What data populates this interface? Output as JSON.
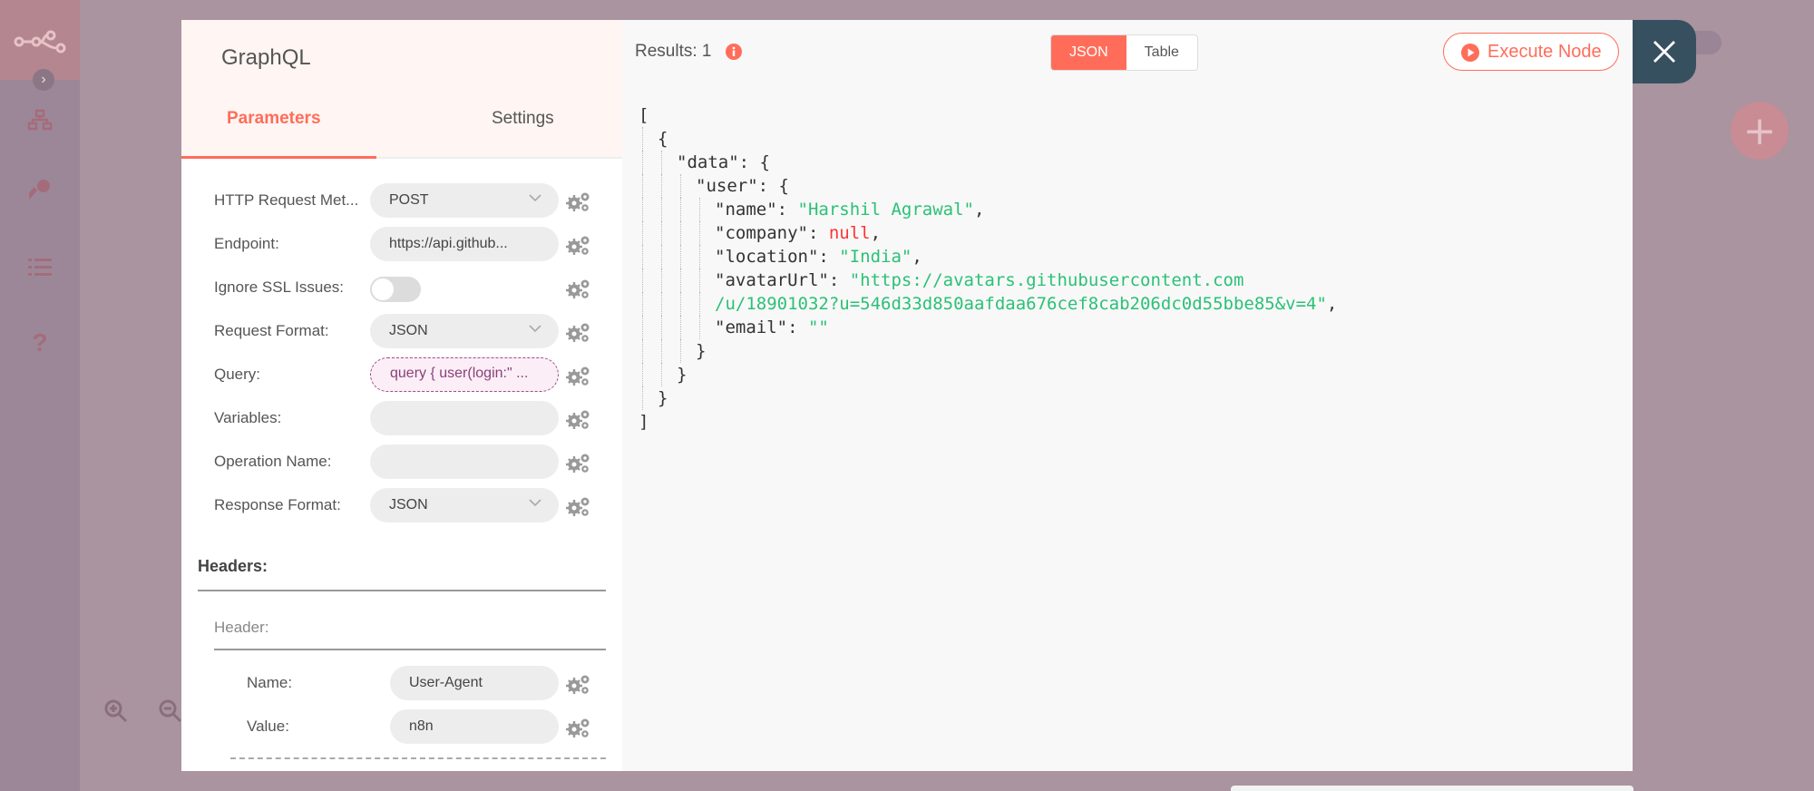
{
  "colors": {
    "accent": "#ff6d5a",
    "close_bg": "#37505f",
    "json_string": "#2bc176",
    "json_null": "#ff3333",
    "query_text": "#8b3f78"
  },
  "node": {
    "title": "GraphQL"
  },
  "tabs": {
    "parameters": "Parameters",
    "settings": "Settings"
  },
  "fields": [
    {
      "label": "HTTP Request Met...",
      "value": "POST",
      "type": "select"
    },
    {
      "label": "Endpoint:",
      "value": "https://api.github...",
      "type": "text"
    },
    {
      "label": "Ignore SSL Issues:",
      "value": "",
      "type": "toggle",
      "checked": false
    },
    {
      "label": "Request Format:",
      "value": "JSON",
      "type": "select"
    },
    {
      "label": "Query:",
      "value": "query { user(login:\" ...",
      "type": "expression"
    },
    {
      "label": "Variables:",
      "value": "",
      "type": "text"
    },
    {
      "label": "Operation Name:",
      "value": "",
      "type": "text"
    },
    {
      "label": "Response Format:",
      "value": "JSON",
      "type": "select"
    }
  ],
  "headers_section": {
    "title": "Headers:",
    "subtitle": "Header:",
    "items": [
      {
        "label": "Name:",
        "value": "User-Agent"
      },
      {
        "label": "Value:",
        "value": "n8n"
      }
    ]
  },
  "output": {
    "results_label": "Results: 1",
    "view_json": "JSON",
    "view_table": "Table",
    "active_view": "JSON",
    "execute_label": "Execute Node",
    "json_lines": [
      {
        "indent": 0,
        "parts": [
          {
            "t": "p",
            "v": "["
          }
        ]
      },
      {
        "indent": 1,
        "parts": [
          {
            "t": "p",
            "v": "{"
          }
        ]
      },
      {
        "indent": 2,
        "parts": [
          {
            "t": "p",
            "v": "\"data\": {"
          }
        ]
      },
      {
        "indent": 3,
        "parts": [
          {
            "t": "p",
            "v": "\"user\": {"
          }
        ]
      },
      {
        "indent": 4,
        "parts": [
          {
            "t": "p",
            "v": "\"name\": "
          },
          {
            "t": "s",
            "v": "\"Harshil Agrawal\""
          },
          {
            "t": "p",
            "v": ","
          }
        ]
      },
      {
        "indent": 4,
        "parts": [
          {
            "t": "p",
            "v": "\"company\": "
          },
          {
            "t": "n",
            "v": "null"
          },
          {
            "t": "p",
            "v": ","
          }
        ]
      },
      {
        "indent": 4,
        "parts": [
          {
            "t": "p",
            "v": "\"location\": "
          },
          {
            "t": "s",
            "v": "\"India\""
          },
          {
            "t": "p",
            "v": ","
          }
        ]
      },
      {
        "indent": 4,
        "parts": [
          {
            "t": "p",
            "v": "\"avatarUrl\": "
          },
          {
            "t": "s",
            "v": "\"https://avatars.githubusercontent.com"
          }
        ]
      },
      {
        "indent": 4,
        "parts": [
          {
            "t": "s",
            "v": "/u/18901032?u=546d33d850aafdaa676cef8cab206dc0d55bbe85&v=4\""
          },
          {
            "t": "p",
            "v": ","
          }
        ]
      },
      {
        "indent": 4,
        "parts": [
          {
            "t": "p",
            "v": "\"email\": "
          },
          {
            "t": "s",
            "v": "\"\""
          }
        ]
      },
      {
        "indent": 3,
        "parts": [
          {
            "t": "p",
            "v": "}"
          }
        ]
      },
      {
        "indent": 2,
        "parts": [
          {
            "t": "p",
            "v": "}"
          }
        ]
      },
      {
        "indent": 1,
        "parts": [
          {
            "t": "p",
            "v": "}"
          }
        ]
      },
      {
        "indent": 0,
        "parts": [
          {
            "t": "p",
            "v": "]"
          }
        ]
      }
    ]
  }
}
